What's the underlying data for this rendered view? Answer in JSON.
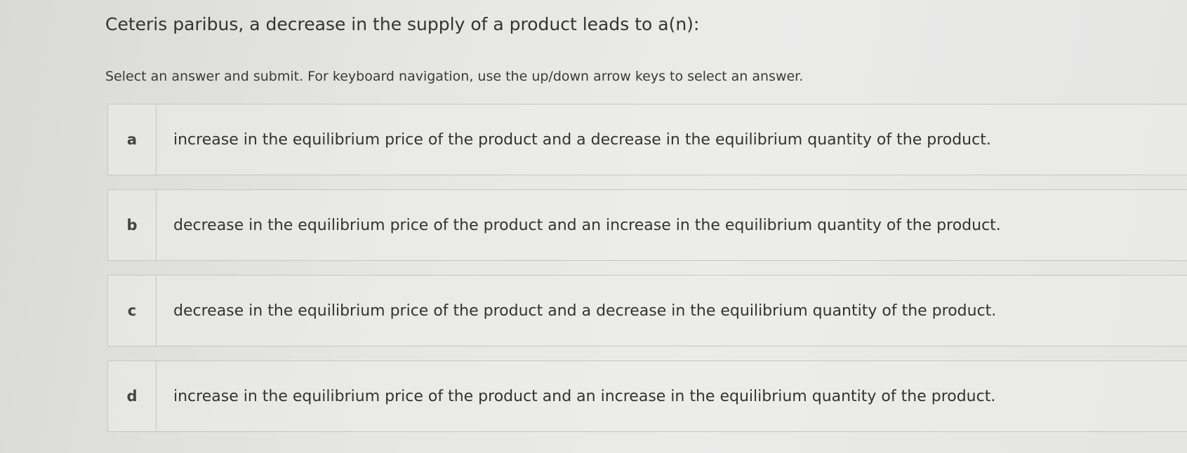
{
  "question": {
    "text": "Ceteris paribus, a decrease in the supply of a product leads to a(n):"
  },
  "instructions": {
    "text": "Select an answer and submit. For keyboard navigation, use the up/down arrow keys to select an answer."
  },
  "answers": [
    {
      "letter": "a",
      "text": "increase in the equilibrium price of the product and a decrease in the equilibrium quantity of the product."
    },
    {
      "letter": "b",
      "text": "decrease in the equilibrium price of the product and an increase in the equilibrium quantity of the product."
    },
    {
      "letter": "c",
      "text": "decrease in the equilibrium price of the product and a decrease in the equilibrium quantity of the product."
    },
    {
      "letter": "d",
      "text": "increase in the equilibrium price of the product and an increase in the equilibrium quantity of the product."
    }
  ]
}
